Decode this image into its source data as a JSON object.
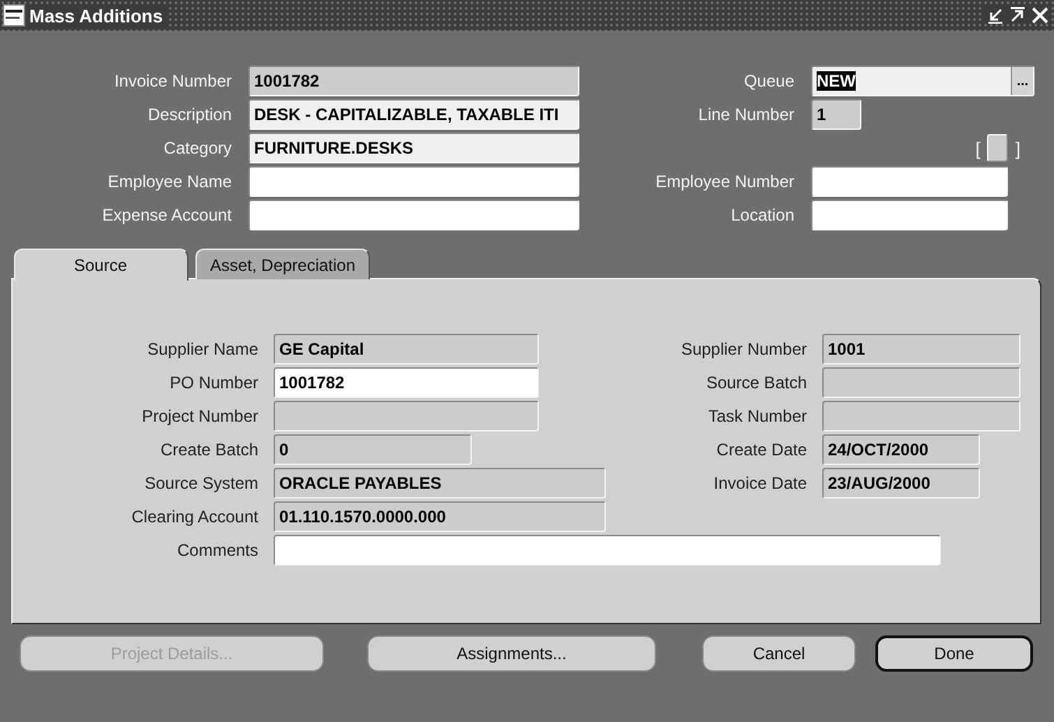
{
  "window": {
    "title": "Mass Additions"
  },
  "header": {
    "rows": [
      {
        "left": {
          "label": "Invoice Number",
          "value": "1001782",
          "kind": "display"
        },
        "right": {
          "label": "Queue",
          "value": "NEW",
          "kind": "lov",
          "value_selected": true,
          "lov_button": "..."
        }
      },
      {
        "left": {
          "label": "Description",
          "value": "DESK - CAPITALIZABLE, TAXABLE ITI",
          "kind": "light"
        },
        "right": {
          "label": "Line Number",
          "value": "1",
          "kind": "display"
        }
      },
      {
        "left": {
          "label": "Category",
          "value": "FURNITURE.DESKS",
          "kind": "light"
        },
        "right": {
          "kind": "flexfield",
          "open": "[",
          "close": "]"
        }
      },
      {
        "left": {
          "label": "Employee Name",
          "kind": "editable"
        },
        "right": {
          "label": "Employee Number",
          "kind": "editable"
        }
      },
      {
        "left": {
          "label": "Expense Account",
          "kind": "editable"
        },
        "right": {
          "label": "Location",
          "kind": "editable"
        }
      }
    ]
  },
  "tabs": [
    {
      "label": "Source",
      "selected": true
    },
    {
      "label": "Asset, Depreciation",
      "selected": false
    }
  ],
  "panel": {
    "rows": [
      {
        "left": {
          "label": "Supplier Name",
          "value": "GE Capital",
          "kind": "display"
        },
        "right": {
          "label": "Supplier Number",
          "value": "1001",
          "kind": "display"
        }
      },
      {
        "left": {
          "label": "PO Number",
          "value": "1001782",
          "kind": "editable"
        },
        "right": {
          "label": "Source Batch",
          "kind": "display"
        }
      },
      {
        "left": {
          "label": "Project Number",
          "kind": "display"
        },
        "right": {
          "label": "Task Number",
          "kind": "display"
        }
      },
      {
        "left": {
          "label": "Create Batch",
          "value": "0",
          "kind": "display"
        },
        "right": {
          "label": "Create Date",
          "value": "24/OCT/2000",
          "kind": "display"
        }
      },
      {
        "left": {
          "label": "Source System",
          "value": "ORACLE PAYABLES",
          "kind": "display"
        },
        "right": {
          "label": "Invoice Date",
          "value": "23/AUG/2000",
          "kind": "display"
        }
      },
      {
        "left": {
          "label": "Clearing Account",
          "value": "01.110.1570.0000.000",
          "kind": "display"
        }
      },
      {
        "left": {
          "label": "Comments",
          "kind": "editable"
        }
      }
    ]
  },
  "buttons": [
    {
      "label": "Project Details...",
      "disabled": true,
      "default": false
    },
    {
      "label": "Assignments...",
      "disabled": false,
      "default": false
    },
    {
      "label": "Cancel",
      "disabled": false,
      "default": false
    },
    {
      "label": "Done",
      "disabled": false,
      "default": true
    }
  ]
}
